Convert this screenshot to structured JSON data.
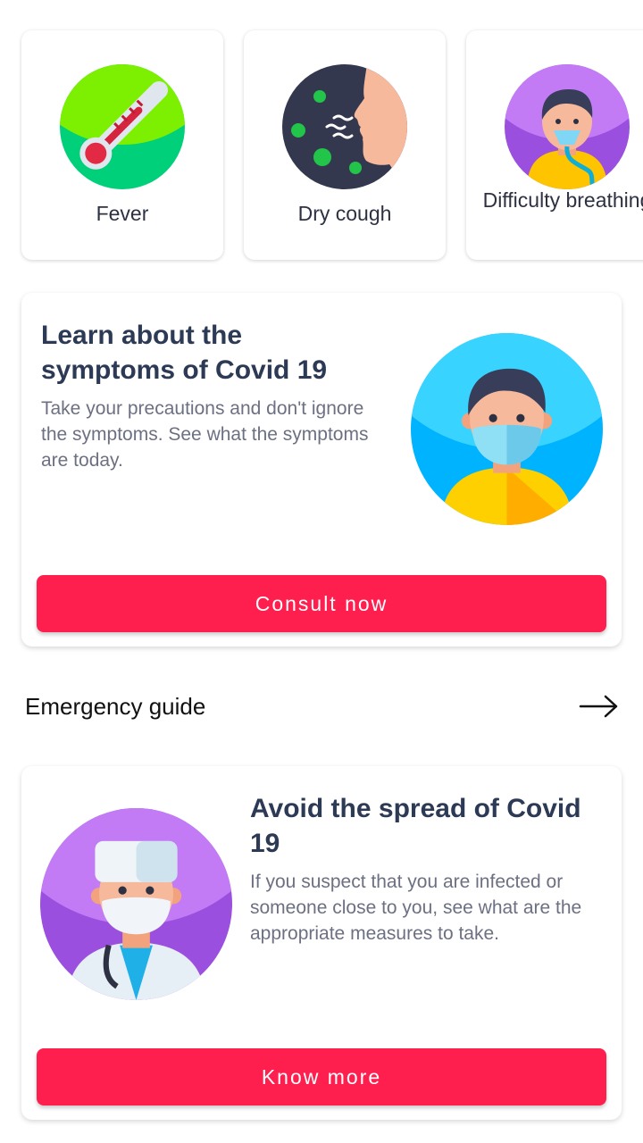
{
  "symptoms": [
    {
      "label": "Fever",
      "icon": "thermometer-icon"
    },
    {
      "label": "Dry cough",
      "icon": "cough-icon"
    },
    {
      "label": "Difficulty breathing",
      "icon": "oxygen-mask-icon"
    }
  ],
  "learn_card": {
    "title": "Learn about the symptoms of Covid 19",
    "description": "Take your precautions and don't ignore the symptoms. See what the symptoms are today.",
    "button_label": "Consult now"
  },
  "emergency": {
    "heading": "Emergency guide",
    "arrow_icon": "arrow-right-icon"
  },
  "spread_card": {
    "title": "Avoid the spread of Covid 19",
    "description": "If you suspect that you are infected or someone close to you, see what are the appropriate measures to take.",
    "button_label": "Know more"
  },
  "colors": {
    "accent": "#ff1f4f",
    "title": "#2d3a55",
    "body_text": "#6c7082"
  }
}
